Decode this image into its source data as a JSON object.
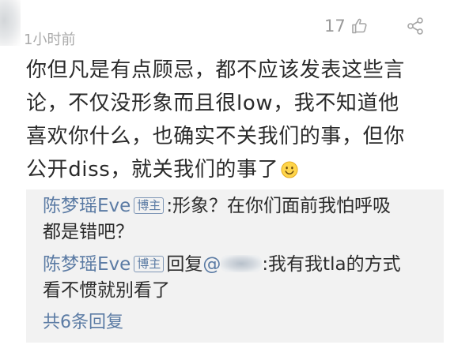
{
  "comment": {
    "timestamp": "1小时前",
    "like_count": "17",
    "lines": [
      "你但凡是有点顾忌，都不应该发表这些言",
      "论，不仅没形象而且很low，我不知道他",
      "喜欢你什么，也确实不关我们的事，但你",
      "公开diss，就关我们的事了"
    ],
    "emoji": "smiley-emoji"
  },
  "replies": [
    {
      "username": "陈梦瑶Eve",
      "badge": "博主",
      "line1": ":形象？在你们面前我怕呼吸",
      "line2": "都是错吧？"
    },
    {
      "username": "陈梦瑶Eve",
      "badge": "博主",
      "reply_word": "回复",
      "mention_prefix": "@",
      "line1": ":我有我tla的方式",
      "line2": "看不惯就别看了"
    }
  ],
  "more_replies_label": "共6条回复",
  "colors": {
    "link": "#5b7ba4",
    "text": "#2a2a2a",
    "muted": "#aaaaaa",
    "reply_bg": "#f2f2f2"
  },
  "icons": [
    "thumbs-up-icon",
    "share-icon",
    "smiley-emoji"
  ]
}
